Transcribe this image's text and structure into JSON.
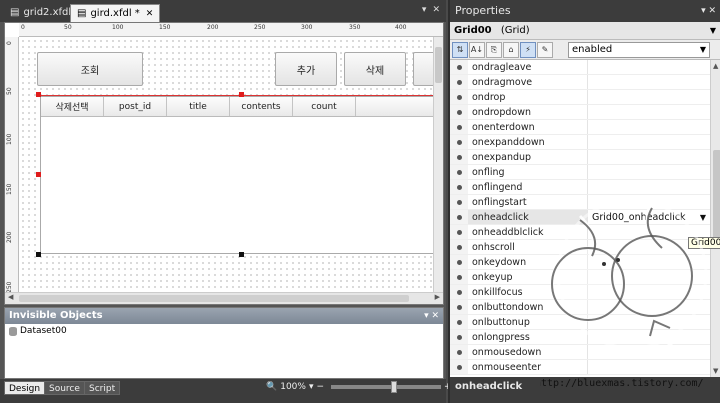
{
  "tabs": [
    {
      "label": "grid2.xfdl"
    },
    {
      "label": "gird.xfdl *"
    }
  ],
  "tab_controls": {
    "pin": "▾",
    "close": "✕"
  },
  "rulers": {
    "h": [
      "0",
      "50",
      "100",
      "150",
      "200",
      "250",
      "300",
      "350",
      "400"
    ],
    "v": [
      "0",
      "50",
      "100",
      "150",
      "200",
      "250"
    ]
  },
  "form": {
    "buttons": {
      "search": "조회",
      "add": "추가",
      "delete": "삭제"
    },
    "grid": {
      "columns": [
        "삭제선택",
        "post_id",
        "title",
        "contents",
        "count"
      ]
    }
  },
  "invisible": {
    "title": "Invisible Objects",
    "controls": "▾ ✕",
    "items": [
      "Dataset00"
    ]
  },
  "bottom": {
    "tabs": [
      "Design",
      "Source",
      "Script"
    ],
    "zoom": "100%",
    "zoom_minus": "−",
    "zoom_plus": "+"
  },
  "properties": {
    "title": "Properties",
    "controls": "▾ ✕",
    "object_name": "Grid00",
    "object_type": "(Grid)",
    "filter_value": "enabled",
    "toolbar": [
      "⇅",
      "A↓",
      "⎘",
      "⌂",
      "⚡",
      "✎"
    ],
    "rows": [
      {
        "name": "ondragleave",
        "value": ""
      },
      {
        "name": "ondragmove",
        "value": ""
      },
      {
        "name": "ondrop",
        "value": ""
      },
      {
        "name": "ondropdown",
        "value": ""
      },
      {
        "name": "onenterdown",
        "value": ""
      },
      {
        "name": "onexpanddown",
        "value": ""
      },
      {
        "name": "onexpandup",
        "value": ""
      },
      {
        "name": "onfling",
        "value": ""
      },
      {
        "name": "onflingend",
        "value": ""
      },
      {
        "name": "onflingstart",
        "value": ""
      },
      {
        "name": "onheadclick",
        "value": "Grid00_onheadclick"
      },
      {
        "name": "onheaddblclick",
        "value": ""
      },
      {
        "name": "onhscroll",
        "value": ""
      },
      {
        "name": "onkeydown",
        "value": ""
      },
      {
        "name": "onkeyup",
        "value": ""
      },
      {
        "name": "onkillfocus",
        "value": ""
      },
      {
        "name": "onlbuttondown",
        "value": ""
      },
      {
        "name": "onlbuttonup",
        "value": ""
      },
      {
        "name": "onlongpress",
        "value": ""
      },
      {
        "name": "onmousedown",
        "value": ""
      },
      {
        "name": "onmouseenter",
        "value": ""
      }
    ],
    "footer": "onheadclick",
    "tooltip": "Grid00_"
  },
  "watermark": {
    "url": "http://bluexmas.tistory.com/"
  },
  "colors": {
    "selection": "#e01c1c",
    "panel_dark": "#3c3c3c",
    "accent": "#cfe0f5"
  }
}
